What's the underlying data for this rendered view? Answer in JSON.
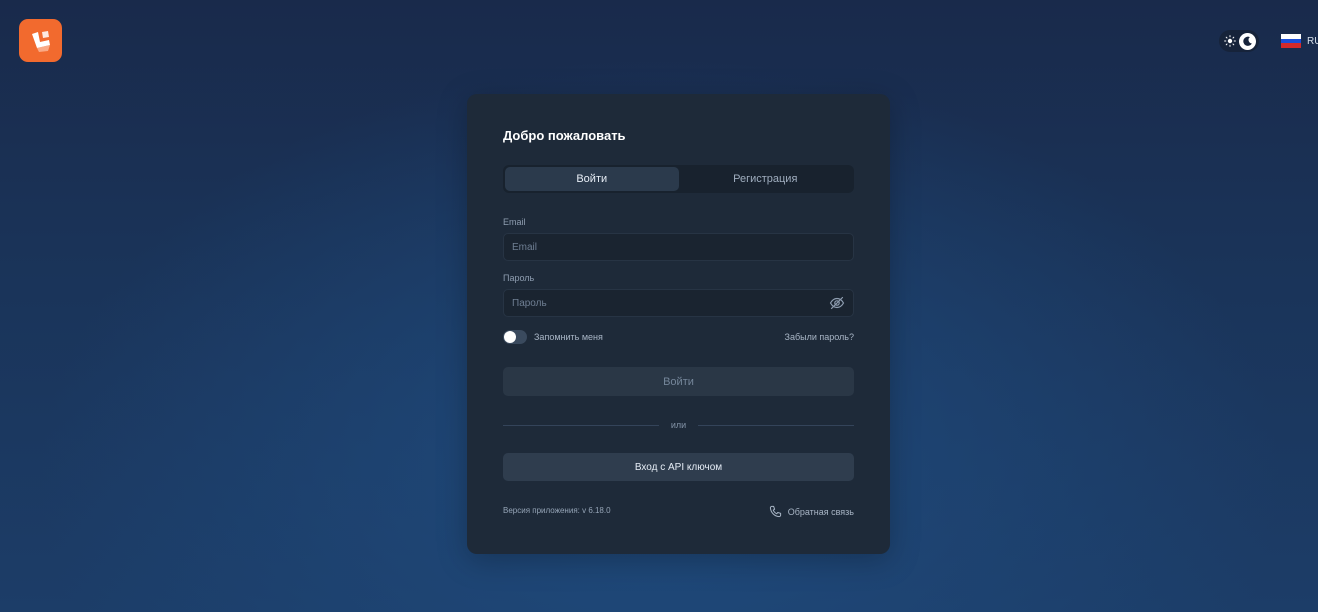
{
  "header": {
    "logo_icon": "brand-logo-icon",
    "theme_toggle": {
      "light_icon": "sun-icon",
      "dark_icon": "moon-icon",
      "active": "dark"
    },
    "language": {
      "code": "RU",
      "flag_icon": "russia-flag-icon"
    }
  },
  "colors": {
    "brand": "#f26a2e",
    "card": "#1e2a39",
    "background": "#1a3358"
  },
  "login": {
    "title": "Добро пожаловать",
    "tabs": [
      {
        "label": "Войти",
        "active": true
      },
      {
        "label": "Регистрация",
        "active": false
      }
    ],
    "email": {
      "label": "Email",
      "placeholder": "Email",
      "value": ""
    },
    "password": {
      "label": "Пароль",
      "placeholder": "Пароль",
      "value": "",
      "toggle_icon": "eye-off-icon"
    },
    "remember": {
      "label": "Запомнить меня",
      "checked": false
    },
    "forgot_label": "Забыли пароль?",
    "submit_label": "Войти",
    "divider_label": "или",
    "api_button_label": "Вход с API ключом",
    "version": "Версия приложения: v 6.18.0",
    "feedback": {
      "label": "Обратная связь",
      "icon": "phone-icon"
    }
  }
}
